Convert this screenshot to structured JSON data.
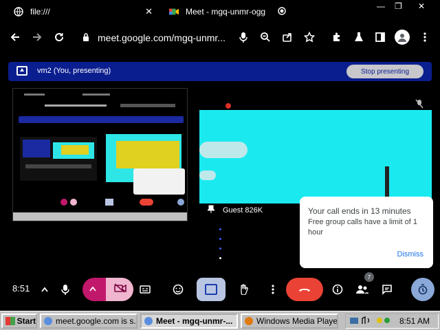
{
  "browser": {
    "tabs": [
      {
        "title": "file:///",
        "close": "✕"
      },
      {
        "title": "Meet - mgq-unmr-ogg",
        "close": "✕"
      }
    ],
    "window_controls": [
      "—",
      "❐",
      "✕"
    ],
    "url": "meet.google.com/mgq-unmr...",
    "icons": [
      "back-icon",
      "forward-icon",
      "reload-icon",
      "lock-icon",
      "mic-icon",
      "zoom-icon",
      "share-icon",
      "star-icon",
      "extensions-icon",
      "flask-icon",
      "sidepanel-icon",
      "profile-icon",
      "menu-icon"
    ]
  },
  "banner": {
    "title": "vm2 (You, presenting)",
    "stop_label": "Stop presenting"
  },
  "guest": {
    "name": "Guest 826K"
  },
  "notice": {
    "title": "Your call ends in 13 minutes",
    "body": "Free group calls have a limit of 1 hour",
    "dismiss": "Dismiss"
  },
  "controls": {
    "time": "8:51",
    "participants_badge": "7"
  },
  "taskbar": {
    "start": "Start",
    "items": [
      {
        "label": "meet.google.com is s..."
      },
      {
        "label": "Meet - mgq-unmr-..."
      },
      {
        "label": "Windows Media Player"
      }
    ],
    "clock": "8:51 AM"
  },
  "colors": {
    "banner_bg": "#0b1e8f",
    "end_call": "#ea4335",
    "guest_video": "#1aeaf0",
    "camera_off_pill": "#c2186b",
    "link_blue": "#1a73e8"
  }
}
